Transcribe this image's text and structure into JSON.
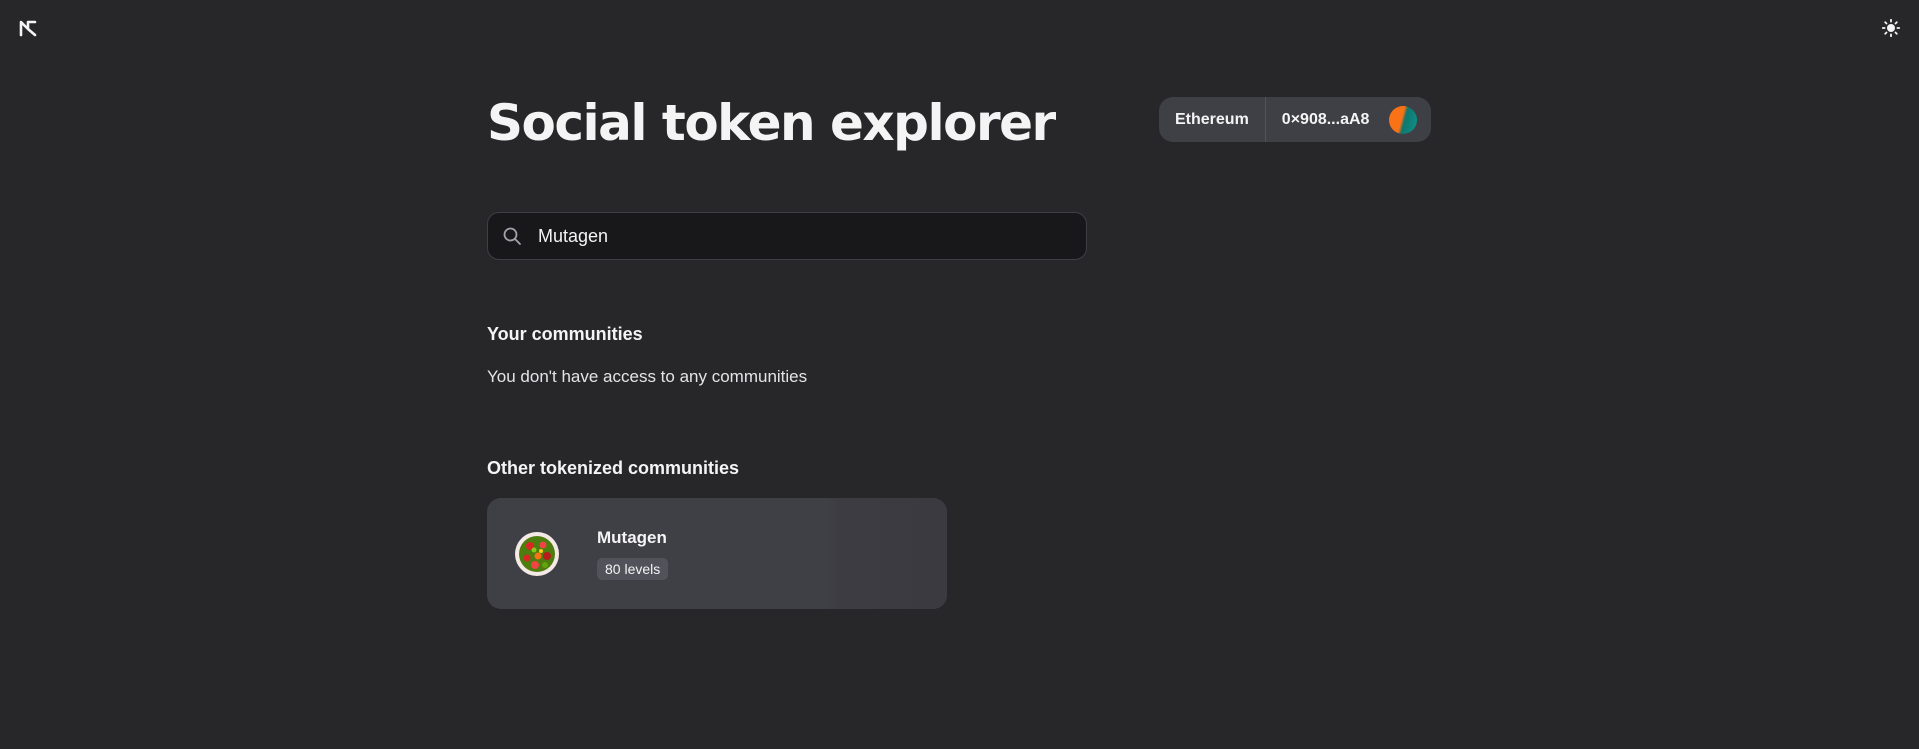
{
  "header": {
    "logo": "guild-logo",
    "theme_toggle_icon": "sun-icon"
  },
  "page": {
    "title": "Social token explorer"
  },
  "account": {
    "chain": "Ethereum",
    "address": "0×908...aA8"
  },
  "search": {
    "value": "Mutagen",
    "icon": "search-icon"
  },
  "your_communities": {
    "title": "Your communities",
    "empty_message": "You don't have access to any communities"
  },
  "other_communities": {
    "title": "Other tokenized communities",
    "items": [
      {
        "name": "Mutagen",
        "levels": "80 levels"
      }
    ]
  },
  "colors": {
    "background": "#27272a",
    "surface": "#3f3f46",
    "input_background": "#18181b",
    "avatar_orange": "#f97316",
    "avatar_teal": "#0d9488"
  }
}
